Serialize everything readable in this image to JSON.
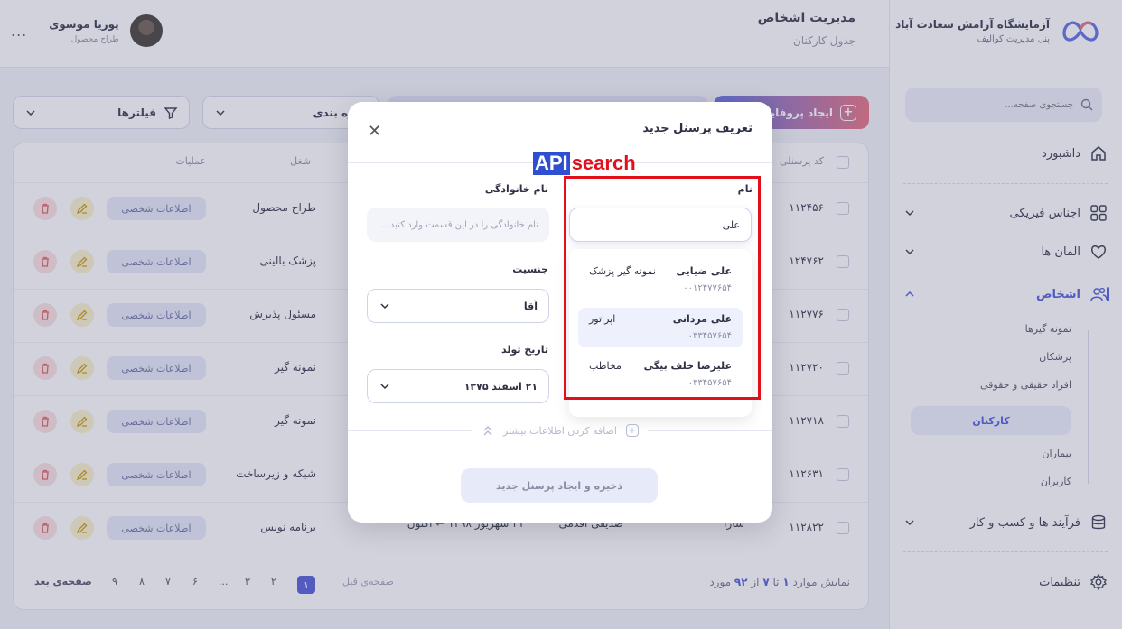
{
  "sidebar": {
    "brand_title": "آزمایشگاه آرامش سعادت آباد",
    "brand_subtitle": "پنل مدیریت کوالیف",
    "search_placeholder": "جستجوی صفحه...",
    "items": [
      {
        "label": "داشبورد"
      },
      {
        "label": "اجناس فیزیکی"
      },
      {
        "label": "المان ها"
      },
      {
        "label": "اشخاص"
      },
      {
        "label": "فرآیند ها و کسب و کار"
      },
      {
        "label": "تنظیمات"
      }
    ],
    "sub_items": [
      "نمونه گیرها",
      "پزشکان",
      "افراد حقیقی و حقوقی",
      "کارکنان",
      "بیماران",
      "کاربران"
    ],
    "active_sub": "کارکنان"
  },
  "header": {
    "title": "مدیریت اشخاص",
    "subtitle": "جدول کارکنان",
    "user_name": "پوریا موسوی",
    "user_role": "طراح محصول",
    "more": "..."
  },
  "toolbar": {
    "create_label": "ایجاد پروفایل",
    "group_label": "گروه بندی",
    "filters_label": "فیلترها"
  },
  "table": {
    "headers": {
      "code": "کد پرسنلی",
      "job": "شغل",
      "ops": "عملیات"
    },
    "info_label": "اطلاعات شخصی",
    "rows": [
      {
        "code": "۱۱۲۴۵۶",
        "job": "طراح محصول"
      },
      {
        "code": "۱۲۴۷۶۲",
        "job": "پزشک بالینی"
      },
      {
        "code": "۱۱۲۷۷۶",
        "job": "مسئول پذیرش"
      },
      {
        "code": "۱۱۲۷۲۰",
        "job": "نمونه گیر"
      },
      {
        "code": "۱۱۲۷۱۸",
        "job": "نمونه گیر"
      },
      {
        "code": "۱۱۲۶۳۱",
        "job": "شبکه و زیرساخت"
      },
      {
        "code": "۱۱۲۸۲۲",
        "job": "برنامه نویس",
        "first_name": "سارا",
        "last_name": "صدیقی اقدمی",
        "period": "۲۱ شهریور ۱۳۹۸ ← اکنون"
      }
    ]
  },
  "pagination": {
    "info_prefix": "نمایش موارد",
    "from": "۱",
    "to_word": "تا",
    "to": "۷",
    "of_word": "از",
    "total": "۹۲",
    "unit": "مورد",
    "prev": "صفحه‌ی قبل",
    "next": "صفحه‌ی بعد",
    "pages": [
      "۱",
      "۲",
      "۳",
      "...",
      "۶",
      "۷",
      "۸",
      "۹"
    ],
    "active_page": "۱"
  },
  "modal": {
    "title": "تعریف پرسنل جدید",
    "close": "✕",
    "name_label": "نام",
    "name_value": "علی",
    "family_label": "نام خانوادگی",
    "family_placeholder": "نام خانوادگی را در این قسمت وارد کنید...",
    "gender_label": "جنسیت",
    "gender_value": "آقا",
    "birth_label": "تاریخ تولد",
    "birth_value": "۲۱ اسفند ۱۳۷۵",
    "add_more": "اضافه کردن اطلاعات بیشتر",
    "save": "ذخیره و ایجاد پرسنل جدید",
    "suggestions": [
      {
        "name": "علی ضیایی",
        "code": "۰۰۱۲۴۷۷۶۵۴",
        "role": "نمونه گیر پزشک"
      },
      {
        "name": "علی مردانی",
        "code": "۰۳۳۴۵۷۶۵۴",
        "role": "اپراتور"
      },
      {
        "name": "علیرضا خلف بیگی",
        "code": "۰۳۳۴۵۷۶۵۴",
        "role": "مخاطب"
      }
    ]
  },
  "annotation": {
    "api": "API",
    "search": "search"
  },
  "colors": {
    "accent": "#4a55d6",
    "annotation": "#e3101c",
    "api_badge": "#2f4fd0"
  }
}
